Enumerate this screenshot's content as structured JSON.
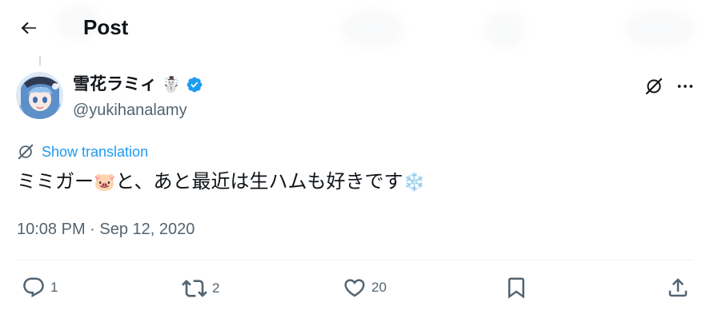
{
  "header": {
    "title": "Post",
    "back_icon": "arrow-left-icon"
  },
  "tweet": {
    "author_name": "雪花ラミィ",
    "name_emoji": "☃️",
    "verified_icon": "verified-badge-icon",
    "handle": "@yukihanalamy",
    "show_translation": "Show translation",
    "text_part1": "ミミガー",
    "text_emoji1": "🐷",
    "text_part2": "と、あと最近は生ハムも好きです",
    "text_emoji2": "❄️",
    "timestamp": "10:08 PM · Sep 12, 2020"
  },
  "actions": {
    "replies": "1",
    "reposts": "2",
    "likes": "20"
  },
  "colors": {
    "accent": "#1d9bf0",
    "text_secondary": "#536471",
    "divider": "#eff3f4"
  }
}
